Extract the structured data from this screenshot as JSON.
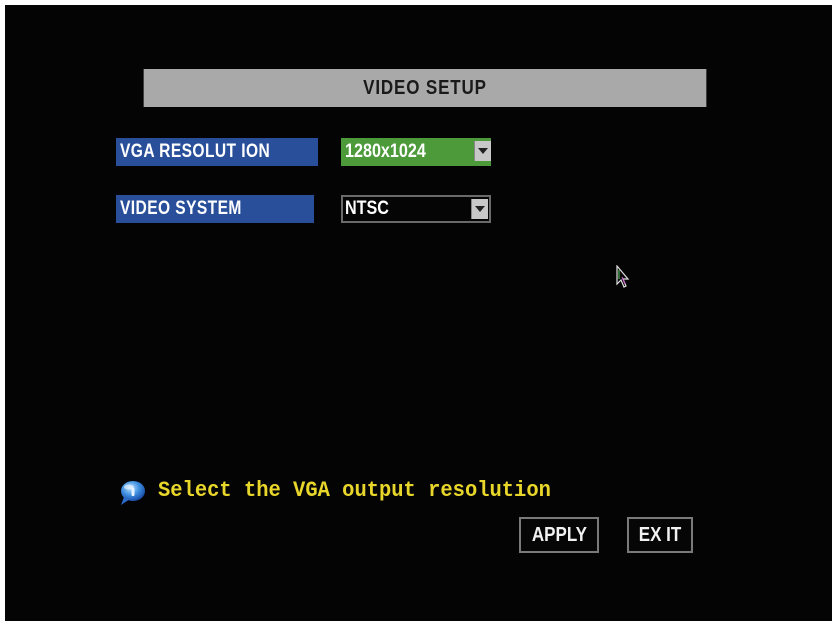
{
  "title": "VIDEO SETUP",
  "fields": [
    {
      "label": "VGA RESOLUT ION",
      "value": "1280x1024"
    },
    {
      "label": "VIDEO SYSTEM",
      "value": "NTSC"
    }
  ],
  "hint": {
    "icon": "info-bubble-icon",
    "text": "Select the VGA output resolution"
  },
  "buttons": {
    "apply": "APPLY",
    "exit": "EX IT"
  },
  "colors": {
    "title_bar": "#a9a9a9",
    "label_bg": "#2a4f9a",
    "selected_field": "#4c9a3a",
    "hint_text": "#e8d62a",
    "screen_bg": "#040404"
  }
}
